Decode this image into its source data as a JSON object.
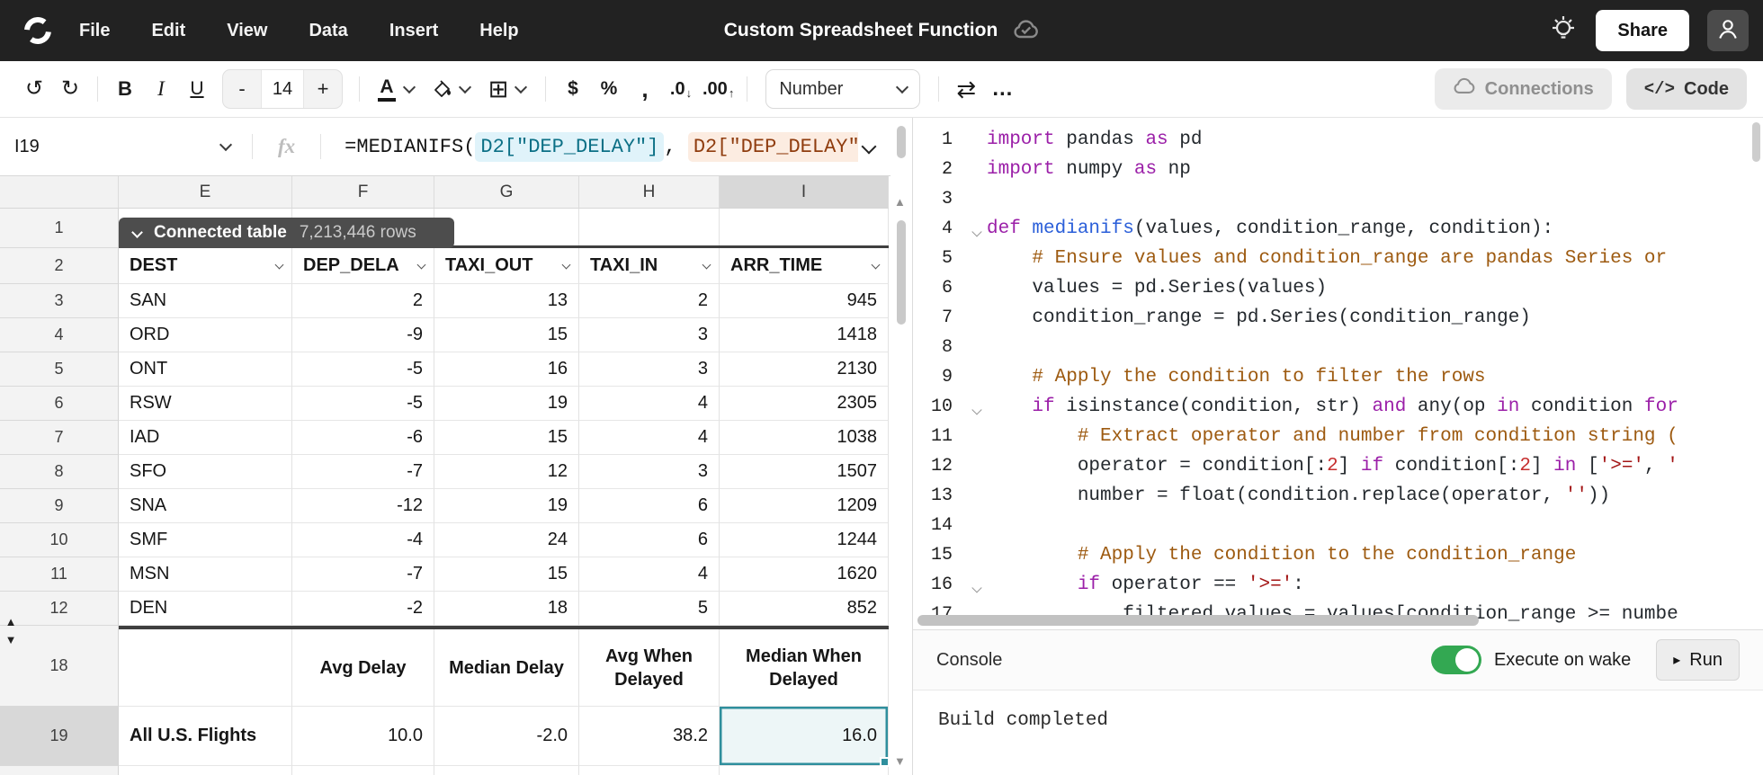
{
  "menu_bar": {
    "items": [
      "File",
      "Edit",
      "View",
      "Data",
      "Insert",
      "Help"
    ],
    "title": "Custom Spreadsheet Function",
    "share_label": "Share"
  },
  "toolbar": {
    "bold": "B",
    "italic": "I",
    "underline": "U",
    "decrease_font": "-",
    "font_size": "14",
    "increase_font": "+",
    "text_color": "A",
    "currency": "$",
    "percent": "%",
    "comma": ",",
    "decimal_decrease": ".0",
    "decimal_increase": ".00",
    "number_format": "Number",
    "connections_label": "Connections",
    "code_label": "Code"
  },
  "formula_bar": {
    "cell_ref": "I19",
    "fx_label": "fx",
    "prefix": "=MEDIANIFS(",
    "arg1": "D2[\"DEP_DELAY\"]",
    "separator": ", ",
    "arg2": "D2[\"DEP_DELAY\"]",
    "suffix": ","
  },
  "grid": {
    "column_headers": [
      "E",
      "F",
      "G",
      "H",
      "I"
    ],
    "row1_num": "1",
    "badge": {
      "label": "Connected table",
      "row_count": "7,213,446 rows"
    },
    "header_row_num": "2",
    "table_headers": [
      "DEST",
      "DEP_DELA",
      "TAXI_OUT",
      "TAXI_IN",
      "ARR_TIME"
    ],
    "data_rows": [
      {
        "num": "3",
        "cells": [
          "SAN",
          "2",
          "13",
          "2",
          "945"
        ]
      },
      {
        "num": "4",
        "cells": [
          "ORD",
          "-9",
          "15",
          "3",
          "1418"
        ]
      },
      {
        "num": "5",
        "cells": [
          "ONT",
          "-5",
          "16",
          "3",
          "2130"
        ]
      },
      {
        "num": "6",
        "cells": [
          "RSW",
          "-5",
          "19",
          "4",
          "2305"
        ]
      },
      {
        "num": "7",
        "cells": [
          "IAD",
          "-6",
          "15",
          "4",
          "1038"
        ]
      },
      {
        "num": "8",
        "cells": [
          "SFO",
          "-7",
          "12",
          "3",
          "1507"
        ]
      },
      {
        "num": "9",
        "cells": [
          "SNA",
          "-12",
          "19",
          "6",
          "1209"
        ]
      },
      {
        "num": "10",
        "cells": [
          "SMF",
          "-4",
          "24",
          "6",
          "1244"
        ]
      },
      {
        "num": "11",
        "cells": [
          "MSN",
          "-7",
          "15",
          "4",
          "1620"
        ]
      },
      {
        "num": "12",
        "cells": [
          "DEN",
          "-2",
          "18",
          "5",
          "852"
        ]
      }
    ],
    "summary_header": {
      "num": "18",
      "cells": [
        "",
        "Avg Delay",
        "Median Delay",
        "Avg When Delayed",
        "Median When Delayed"
      ]
    },
    "summary_row": {
      "num": "19",
      "label": "All U.S. Flights",
      "values": [
        "10.0",
        "-2.0",
        "38.2",
        "16.0"
      ]
    }
  },
  "code_editor": {
    "lines": [
      {
        "n": "1",
        "fold": false,
        "tokens": [
          {
            "c": "kw",
            "t": "import"
          },
          {
            "c": "pl",
            "t": " pandas "
          },
          {
            "c": "kw",
            "t": "as"
          },
          {
            "c": "pl",
            "t": " pd"
          }
        ]
      },
      {
        "n": "2",
        "fold": false,
        "tokens": [
          {
            "c": "kw",
            "t": "import"
          },
          {
            "c": "pl",
            "t": " numpy "
          },
          {
            "c": "kw",
            "t": "as"
          },
          {
            "c": "pl",
            "t": " np"
          }
        ]
      },
      {
        "n": "3",
        "fold": false,
        "tokens": []
      },
      {
        "n": "4",
        "fold": true,
        "tokens": [
          {
            "c": "kw",
            "t": "def"
          },
          {
            "c": "pl",
            "t": " "
          },
          {
            "c": "fn",
            "t": "medianifs"
          },
          {
            "c": "pl",
            "t": "(values, condition_range, condition):"
          }
        ]
      },
      {
        "n": "5",
        "fold": false,
        "tokens": [
          {
            "c": "pl",
            "t": "    "
          },
          {
            "c": "cm",
            "t": "# Ensure values and condition_range are pandas Series or"
          }
        ]
      },
      {
        "n": "6",
        "fold": false,
        "tokens": [
          {
            "c": "pl",
            "t": "    values = pd.Series(values)"
          }
        ]
      },
      {
        "n": "7",
        "fold": false,
        "tokens": [
          {
            "c": "pl",
            "t": "    condition_range = pd.Series(condition_range)"
          }
        ]
      },
      {
        "n": "8",
        "fold": false,
        "tokens": []
      },
      {
        "n": "9",
        "fold": false,
        "tokens": [
          {
            "c": "pl",
            "t": "    "
          },
          {
            "c": "cm",
            "t": "# Apply the condition to filter the rows"
          }
        ]
      },
      {
        "n": "10",
        "fold": true,
        "tokens": [
          {
            "c": "pl",
            "t": "    "
          },
          {
            "c": "kw",
            "t": "if"
          },
          {
            "c": "pl",
            "t": " isinstance(condition, str) "
          },
          {
            "c": "kw",
            "t": "and"
          },
          {
            "c": "pl",
            "t": " any(op "
          },
          {
            "c": "kw",
            "t": "in"
          },
          {
            "c": "pl",
            "t": " condition "
          },
          {
            "c": "kw",
            "t": "for"
          }
        ]
      },
      {
        "n": "11",
        "fold": false,
        "tokens": [
          {
            "c": "pl",
            "t": "        "
          },
          {
            "c": "cm",
            "t": "# Extract operator and number from condition string ("
          }
        ]
      },
      {
        "n": "12",
        "fold": false,
        "tokens": [
          {
            "c": "pl",
            "t": "        operator = condition[:"
          },
          {
            "c": "nm",
            "t": "2"
          },
          {
            "c": "pl",
            "t": "] "
          },
          {
            "c": "kw",
            "t": "if"
          },
          {
            "c": "pl",
            "t": " condition[:"
          },
          {
            "c": "nm",
            "t": "2"
          },
          {
            "c": "pl",
            "t": "] "
          },
          {
            "c": "kw",
            "t": "in"
          },
          {
            "c": "pl",
            "t": " ["
          },
          {
            "c": "st",
            "t": "'>='"
          },
          {
            "c": "pl",
            "t": ", "
          },
          {
            "c": "st",
            "t": "'"
          }
        ]
      },
      {
        "n": "13",
        "fold": false,
        "tokens": [
          {
            "c": "pl",
            "t": "        number = float(condition.replace(operator, "
          },
          {
            "c": "st",
            "t": "''"
          },
          {
            "c": "pl",
            "t": "))"
          }
        ]
      },
      {
        "n": "14",
        "fold": false,
        "tokens": []
      },
      {
        "n": "15",
        "fold": false,
        "tokens": [
          {
            "c": "pl",
            "t": "        "
          },
          {
            "c": "cm",
            "t": "# Apply the condition to the condition_range"
          }
        ]
      },
      {
        "n": "16",
        "fold": true,
        "tokens": [
          {
            "c": "pl",
            "t": "        "
          },
          {
            "c": "kw",
            "t": "if"
          },
          {
            "c": "pl",
            "t": " operator == "
          },
          {
            "c": "st",
            "t": "'>='"
          },
          {
            "c": "pl",
            "t": ":"
          }
        ]
      },
      {
        "n": "17",
        "fold": false,
        "tokens": [
          {
            "c": "pl",
            "t": "            filtered_values = values[condition_range >= numbe"
          }
        ]
      }
    ]
  },
  "console": {
    "title": "Console",
    "toggle_label": "Execute on wake",
    "run_label": "Run",
    "output": "Build completed"
  },
  "icons": {
    "undo": "↺",
    "redo": "↻",
    "borders": "⊞",
    "exchange": "⇄",
    "more": "…",
    "code": "</>",
    "run_play": "▸",
    "scroll_up": "▲",
    "scroll_down": "▼",
    "hidden_rows_up": "▲",
    "hidden_rows_down": "▼",
    "dec_down": "↓",
    "dec_up": "↑"
  },
  "colors": {
    "menubar_bg": "#222222",
    "badge_bg": "#4d4d4d",
    "selection_teal": "#2f8f9d",
    "selection_fill": "#edf6f7",
    "keyword": "#9b1fa8",
    "function_name": "#2b5fd9",
    "comment": "#9d5a10",
    "string": "#a31515",
    "number": "#c62f2f",
    "arg1_bg": "#e0f3fa",
    "arg1_text": "#0c7086",
    "arg2_bg": "#fcece1",
    "arg2_text": "#8f3c0e",
    "toggle_green": "#33a852"
  }
}
